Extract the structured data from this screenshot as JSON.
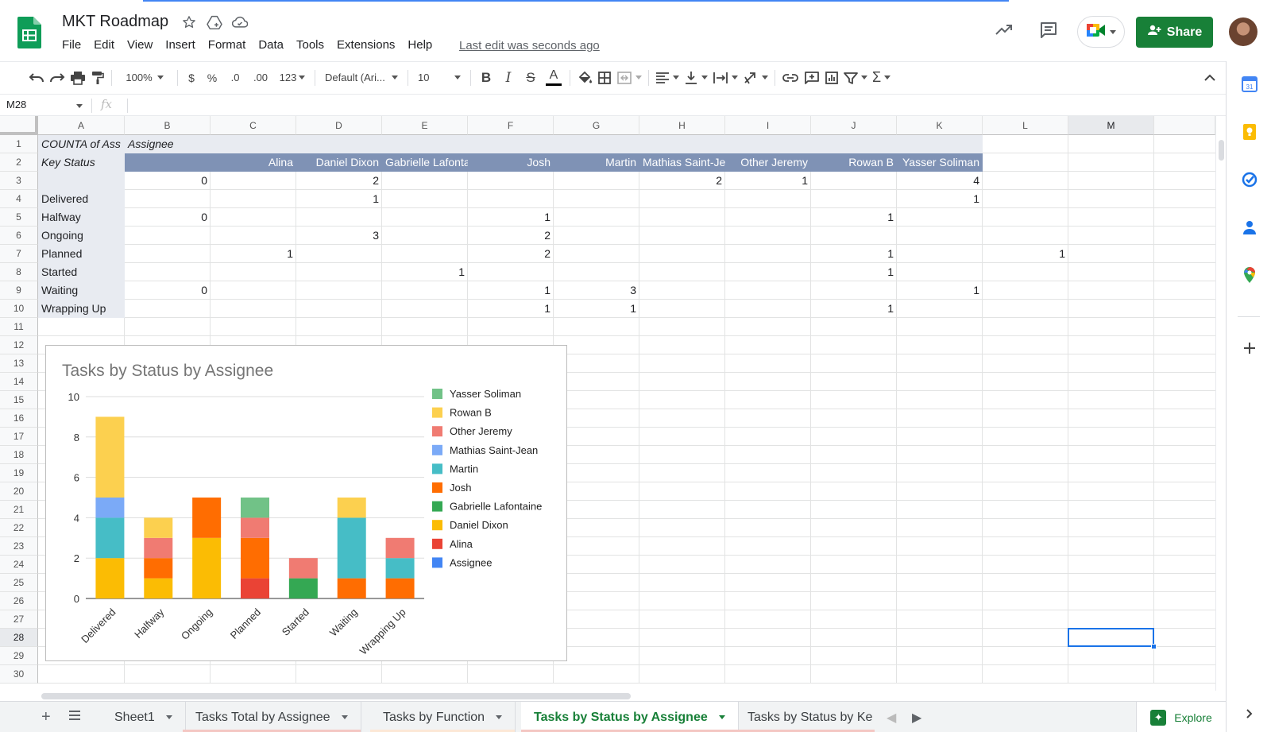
{
  "doc": {
    "title": "MKT Roadmap",
    "menus": [
      "File",
      "Edit",
      "View",
      "Insert",
      "Format",
      "Data",
      "Tools",
      "Extensions",
      "Help"
    ],
    "last_edit": "Last edit was seconds ago",
    "share_label": "Share"
  },
  "toolbar": {
    "zoom": "100%",
    "currency": "$",
    "percent": "%",
    "dec_less": ".0",
    "dec_more": ".00",
    "more_formats": "123",
    "font": "Default (Ari...",
    "font_size": "10"
  },
  "formula_bar": {
    "cell_ref": "M28",
    "fx": "fx",
    "value": ""
  },
  "grid": {
    "columns": [
      "A",
      "B",
      "C",
      "D",
      "E",
      "F",
      "G",
      "H",
      "I",
      "J",
      "K",
      "L",
      "M"
    ],
    "selected_column": "M",
    "rows": [
      "1",
      "2",
      "3",
      "4",
      "5",
      "6",
      "7",
      "8",
      "9",
      "10",
      "11",
      "12",
      "13",
      "14",
      "15",
      "16",
      "17",
      "18",
      "19",
      "20",
      "21",
      "22",
      "23",
      "24",
      "25",
      "26",
      "27",
      "28",
      "29",
      "30"
    ],
    "selected_row": "28",
    "pivot": {
      "corner_label": "COUNTA of Ass",
      "column_field": "Assignee",
      "row_field": "Key Status",
      "assignees": [
        "",
        "Alina",
        "Daniel Dixon",
        "Gabrielle Lafontaine",
        "Josh",
        "Martin",
        "Mathias Saint-Jean",
        "Other Jeremy",
        "Rowan B",
        "Yasser Soliman"
      ],
      "rows": [
        {
          "status": "",
          "values": [
            "",
            "0",
            "",
            "2",
            "",
            "",
            "",
            "2",
            "1",
            "",
            "4"
          ]
        },
        {
          "status": "Delivered",
          "values": [
            "",
            "",
            "",
            "1",
            "",
            "",
            "",
            "",
            "",
            "",
            "1"
          ]
        },
        {
          "status": "Halfway",
          "values": [
            "",
            "0",
            "",
            "",
            "",
            "1",
            "",
            "",
            "",
            "1",
            ""
          ]
        },
        {
          "status": "Ongoing",
          "values": [
            "",
            "",
            "",
            "3",
            "",
            "2",
            "",
            "",
            "",
            "",
            ""
          ]
        },
        {
          "status": "Planned",
          "values": [
            "",
            "",
            "1",
            "",
            "",
            "2",
            "",
            "",
            "",
            "1",
            "",
            "1"
          ]
        },
        {
          "status": "Started",
          "values": [
            "",
            "",
            "",
            "",
            "1",
            "",
            "",
            "",
            "",
            "1",
            ""
          ]
        },
        {
          "status": "Waiting",
          "values": [
            "",
            "0",
            "",
            "",
            "",
            "1",
            "3",
            "",
            "",
            "",
            "1"
          ]
        },
        {
          "status": "Wrapping Up",
          "values": [
            "",
            "",
            "",
            "",
            "",
            "1",
            "1",
            "",
            "",
            "1",
            ""
          ]
        }
      ]
    }
  },
  "chart_data": {
    "type": "bar",
    "stacked": true,
    "title": "Tasks by Status by Assignee",
    "categories": [
      "Delivered",
      "Halfway",
      "Ongoing",
      "Planned",
      "Started",
      "Waiting",
      "Wrapping Up"
    ],
    "ylim": [
      0,
      10
    ],
    "yticks": [
      0,
      2,
      4,
      6,
      8,
      10
    ],
    "legend_position": "right",
    "grid": true,
    "series": [
      {
        "name": "Assignee",
        "color": "#4285f4",
        "values": [
          0,
          0,
          0,
          0,
          0,
          0,
          0
        ]
      },
      {
        "name": "Alina",
        "color": "#ea4335",
        "values": [
          0,
          0,
          0,
          1,
          0,
          0,
          0
        ]
      },
      {
        "name": "Daniel Dixon",
        "color": "#fbbc04",
        "values": [
          2,
          1,
          3,
          0,
          0,
          0,
          0
        ]
      },
      {
        "name": "Gabrielle Lafontaine",
        "color": "#34a853",
        "values": [
          0,
          0,
          0,
          0,
          1,
          0,
          0
        ]
      },
      {
        "name": "Josh",
        "color": "#ff6d01",
        "values": [
          0,
          1,
          2,
          2,
          0,
          1,
          1
        ]
      },
      {
        "name": "Martin",
        "color": "#46bdc6",
        "values": [
          2,
          0,
          0,
          0,
          0,
          3,
          1
        ]
      },
      {
        "name": "Mathias Saint-Jean",
        "color": "#7baaf7",
        "values": [
          1,
          0,
          0,
          0,
          0,
          0,
          0
        ]
      },
      {
        "name": "Other Jeremy",
        "color": "#f07b72",
        "values": [
          0,
          1,
          0,
          1,
          1,
          0,
          1
        ]
      },
      {
        "name": "Rowan B",
        "color": "#fcd04f",
        "values": [
          4,
          1,
          0,
          0,
          0,
          1,
          0
        ]
      },
      {
        "name": "Yasser Soliman",
        "color": "#71c287",
        "values": [
          0,
          0,
          0,
          1,
          0,
          0,
          0
        ]
      }
    ],
    "legend_order": [
      "Yasser Soliman",
      "Rowan B",
      "Other Jeremy",
      "Mathias Saint-Jean",
      "Martin",
      "Josh",
      "Gabrielle Lafontaine",
      "Daniel Dixon",
      "Alina",
      "Assignee"
    ]
  },
  "sheet_tabs": [
    {
      "label": "Sheet1",
      "active": false,
      "color": ""
    },
    {
      "label": "Tasks Total by Assignee",
      "active": false,
      "color": "#f4c7c3"
    },
    {
      "label": "Tasks by Function",
      "active": false,
      "color": "#fce8d6"
    },
    {
      "label": "Tasks by Status by Assignee",
      "active": true,
      "color": "#f4c7c3"
    },
    {
      "label": "Tasks by Status by Ke",
      "active": false,
      "color": "#f4c7c3"
    }
  ],
  "explore_label": "Explore",
  "side_panel": [
    "calendar-icon",
    "keep-icon",
    "tasks-icon",
    "contacts-icon",
    "maps-icon",
    "add-icon"
  ],
  "colors": {
    "brand_green": "#188038",
    "pivot_header": "#7f92b5",
    "pivot_label_bg": "#e8ebf1",
    "selection": "#1a73e8"
  }
}
